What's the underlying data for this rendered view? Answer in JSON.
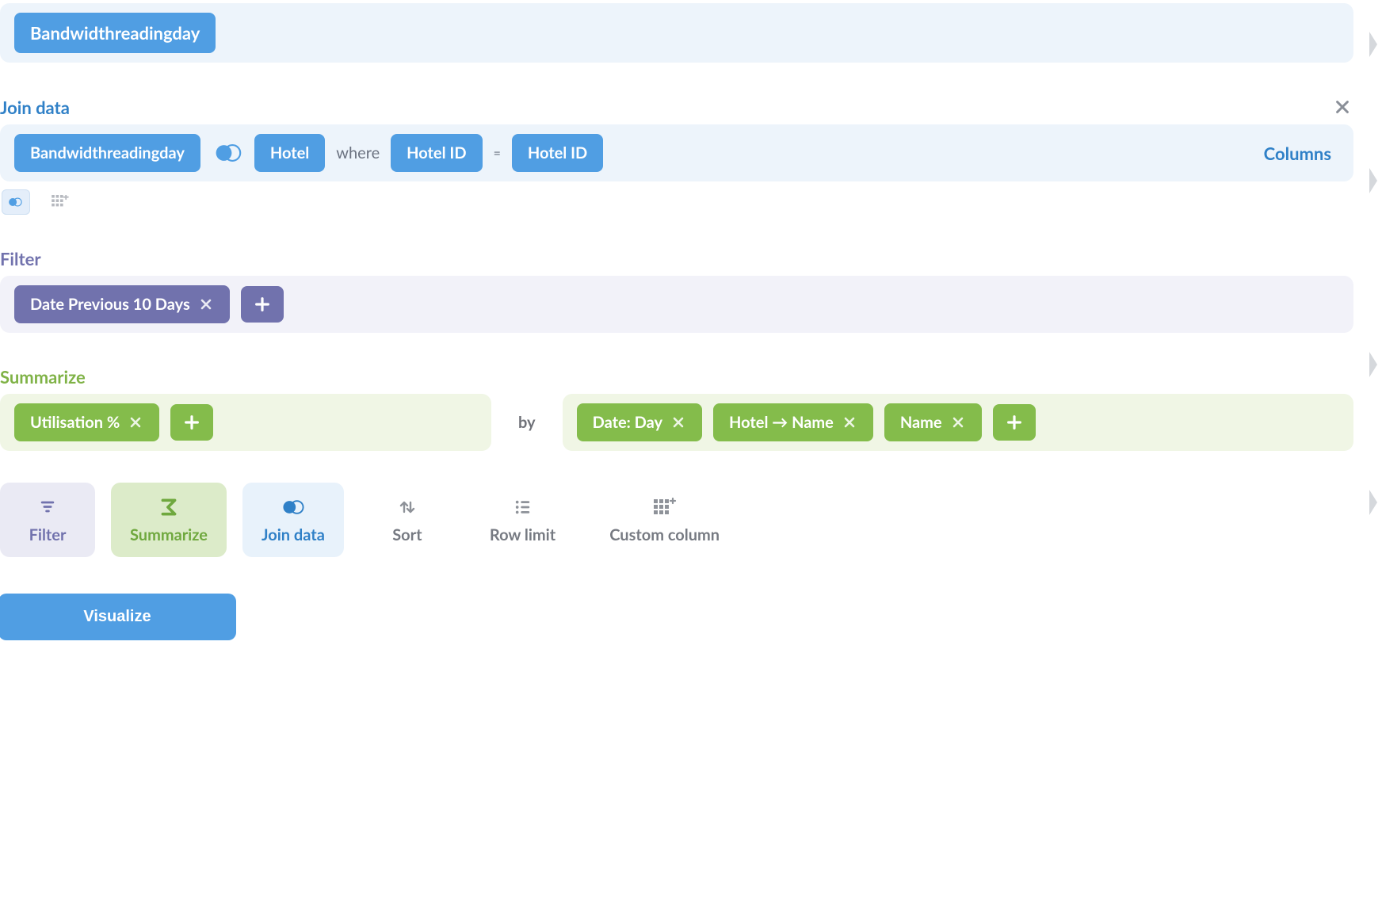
{
  "data_source": {
    "primary": "Bandwidthreadingday"
  },
  "join": {
    "label": "Join data",
    "left_table": "Bandwidthreadingday",
    "right_table": "Hotel",
    "where_label": "where",
    "left_key": "Hotel ID",
    "eq_label": "=",
    "right_key": "Hotel ID",
    "columns_label": "Columns"
  },
  "filter": {
    "label": "Filter",
    "chips": [
      {
        "text": "Date Previous 10 Days"
      }
    ]
  },
  "summarize": {
    "label": "Summarize",
    "metrics": [
      {
        "text": "Utilisation %"
      }
    ],
    "by_label": "by",
    "groupings": [
      {
        "text": "Date: Day"
      },
      {
        "text": "Hotel → Name"
      },
      {
        "text": "Name"
      }
    ]
  },
  "toolbar": {
    "filter": {
      "label": "Filter"
    },
    "summarize": {
      "label": "Summarize"
    },
    "join": {
      "label": "Join data"
    },
    "sort": {
      "label": "Sort"
    },
    "row_limit": {
      "label": "Row limit"
    },
    "custom_column": {
      "label": "Custom column"
    }
  },
  "visualize_label": "Visualize"
}
